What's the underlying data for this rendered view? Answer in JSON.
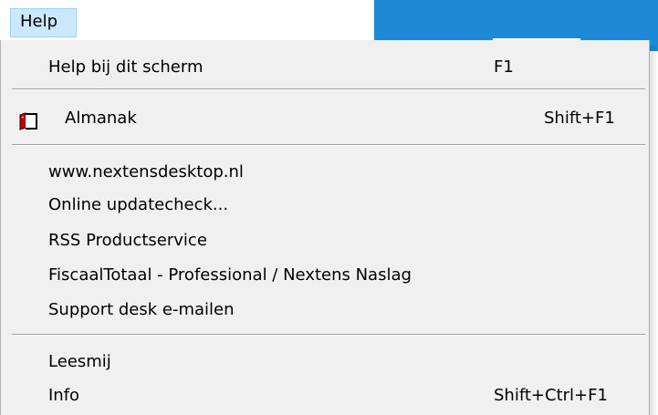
{
  "menubar": {
    "active_menu": "Help"
  },
  "menu": {
    "items": [
      {
        "label": "Help bij dit scherm",
        "shortcut": "F1"
      },
      {
        "label": "Almanak",
        "shortcut": "Shift+F1",
        "icon": "book-icon"
      },
      {
        "label": "www.nextensdesktop.nl"
      },
      {
        "label": "Online updatecheck..."
      },
      {
        "label": "RSS Productservice"
      },
      {
        "label": "FiscaalTotaal - Professional / Nextens Naslag"
      },
      {
        "label": "Support desk e-mailen"
      },
      {
        "label": "Leesmij"
      },
      {
        "label": "Info",
        "shortcut": "Shift+Ctrl+F1"
      }
    ]
  }
}
